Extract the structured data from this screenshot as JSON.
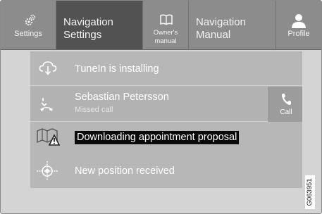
{
  "topbar": {
    "settings": {
      "label": "Settings",
      "icon": "gears-icon"
    },
    "nav_settings": {
      "label": "Navigation Settings"
    },
    "owners_manual": {
      "label": "Owner's manual",
      "icon": "book-icon"
    },
    "nav_manual": {
      "label": "Navigation Manual"
    },
    "profile": {
      "label": "Profile",
      "icon": "person-icon"
    }
  },
  "notifications": [
    {
      "icon": "cloud-download-icon",
      "text": "TuneIn is installing"
    },
    {
      "icon": "missed-call-icon",
      "title": "Sebastian Petersson",
      "subtitle": "Missed call",
      "action_label": "Call",
      "action_icon": "phone-icon"
    },
    {
      "icon": "map-warning-icon",
      "text": "Downloading appointment proposal"
    },
    {
      "icon": "position-crosshair-icon",
      "text": "New position received"
    }
  ],
  "figure_code": "G063951",
  "colors": {
    "topbar": "#8c8c8c",
    "active_tab": "#525252",
    "panel": "#b7b7b7",
    "highlight_row": "#e3e3e3",
    "text_highlight": "#0a0a0a"
  }
}
